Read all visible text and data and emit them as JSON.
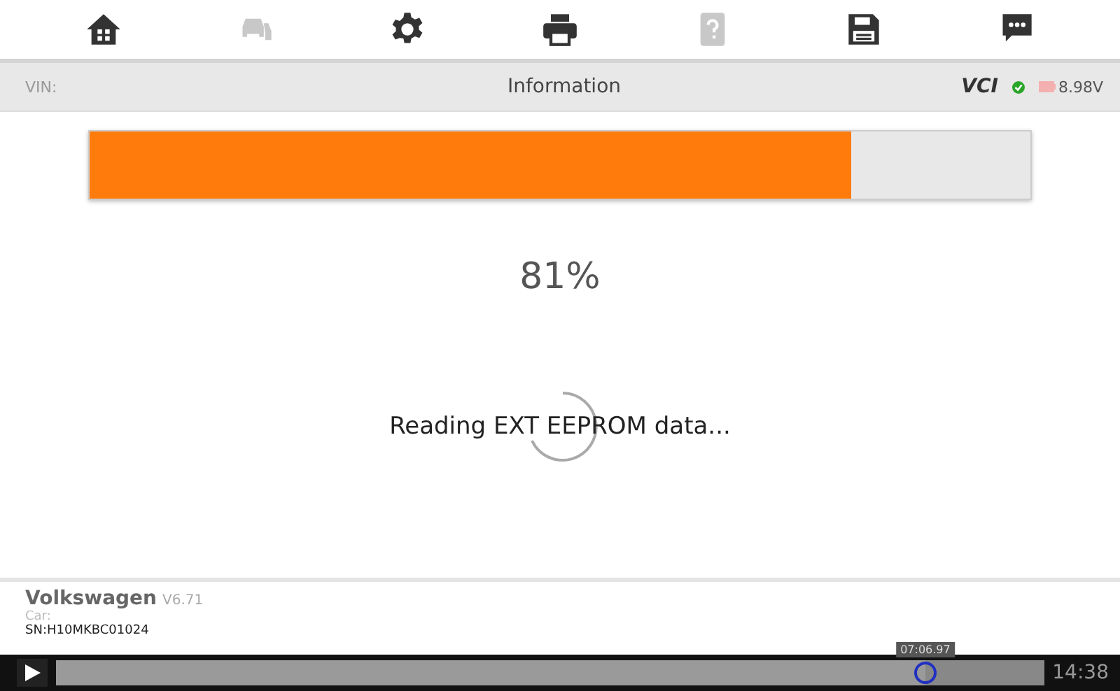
{
  "toolbar": {
    "items": [
      {
        "kind": "home",
        "disabled": false
      },
      {
        "kind": "cars",
        "disabled": true
      },
      {
        "kind": "settings",
        "disabled": false
      },
      {
        "kind": "print",
        "disabled": false
      },
      {
        "kind": "help",
        "disabled": true
      },
      {
        "kind": "save",
        "disabled": false
      },
      {
        "kind": "chat",
        "disabled": false
      }
    ]
  },
  "header": {
    "vin_label": "VIN:",
    "title": "Information",
    "vci": "VCI",
    "vci_connected": true,
    "battery": "8.98V"
  },
  "progress": {
    "level": 0.81,
    "percent": "81%"
  },
  "status": "Reading EXT EEPROM data...",
  "footer": {
    "brand": "Volkswagen",
    "version": "V6.71",
    "car_label": "Car:",
    "serial": "SN:H10MKBC01024"
  },
  "player": {
    "level": 0.88,
    "tooltip": "07:06.97",
    "time": "14:38"
  }
}
